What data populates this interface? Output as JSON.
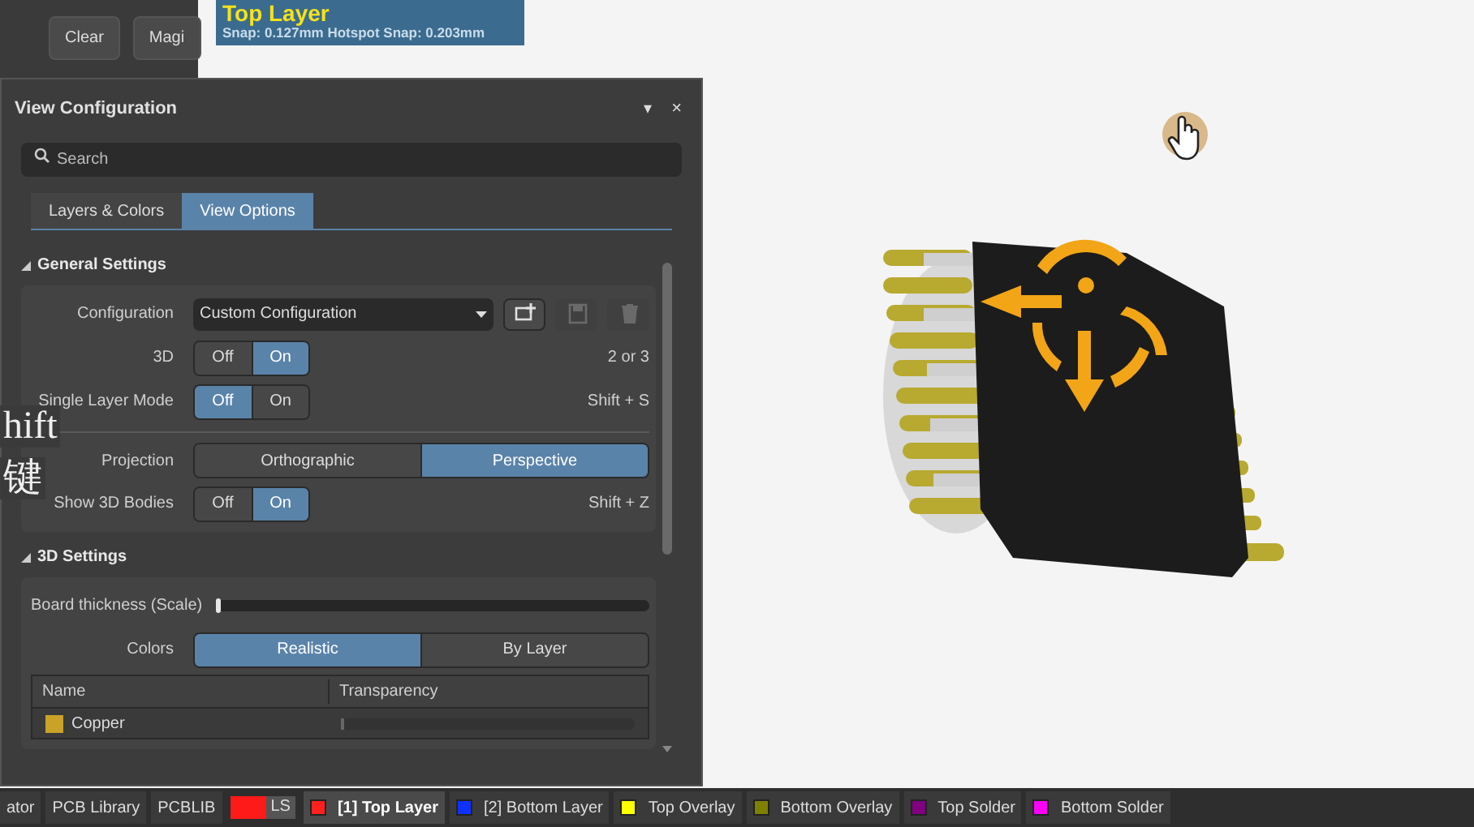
{
  "toolbar_fragment": {
    "buttons": [
      "Clear",
      "Magi"
    ]
  },
  "layer_info": {
    "layer": "Top Layer",
    "snap": "Snap: 0.127mm Hotspot Snap: 0.203mm"
  },
  "panel": {
    "title": "View Configuration",
    "menu_glyph": "▾",
    "close_glyph": "×",
    "search": {
      "placeholder": "Search"
    },
    "tabs": [
      {
        "label": "Layers & Colors",
        "selected": false
      },
      {
        "label": "View Options",
        "selected": true
      }
    ],
    "sections": [
      {
        "title": "General Settings",
        "expanded": true,
        "rows": [
          {
            "kind": "dropdown",
            "label": "Configuration",
            "value": "Custom Configuration",
            "actions": [
              {
                "kind": "add",
                "disabled": false
              },
              {
                "kind": "save",
                "disabled": true
              },
              {
                "kind": "delete",
                "disabled": true
              }
            ]
          },
          {
            "kind": "toggle",
            "label": "3D",
            "options": [
              {
                "label": "Off",
                "selected": false
              },
              {
                "label": "On",
                "selected": true
              }
            ],
            "shortcut": "2 or 3"
          },
          {
            "kind": "toggle",
            "label": "Single Layer Mode",
            "options": [
              {
                "label": "Off",
                "selected": true
              },
              {
                "label": "On",
                "selected": false
              }
            ],
            "shortcut": "Shift + S"
          },
          {
            "kind": "segmented",
            "label": "Projection",
            "separated": true,
            "options": [
              {
                "label": "Orthographic",
                "selected": false
              },
              {
                "label": "Perspective",
                "selected": true
              }
            ]
          },
          {
            "kind": "toggle",
            "label": "Show 3D Bodies",
            "options": [
              {
                "label": "Off",
                "selected": false
              },
              {
                "label": "On",
                "selected": true
              }
            ],
            "shortcut": "Shift + Z"
          }
        ]
      },
      {
        "title": "3D Settings",
        "expanded": true,
        "rows": [
          {
            "kind": "slider",
            "label": "Board thickness (Scale)",
            "level": 0
          },
          {
            "kind": "segmented",
            "label": "Colors",
            "options": [
              {
                "label": "Realistic",
                "selected": true
              },
              {
                "label": "By Layer",
                "selected": false
              }
            ]
          },
          {
            "kind": "table",
            "columns": [
              "Name",
              "Transparency"
            ],
            "rows": [
              {
                "name": "Copper",
                "color": "#c9a227",
                "level": 0
              }
            ]
          }
        ]
      }
    ]
  },
  "captions": [
    "hift",
    "键"
  ],
  "status_bar": {
    "documents": [
      {
        "label": "ator",
        "selected": false
      },
      {
        "label": "PCB Library",
        "selected": false
      },
      {
        "label": "PCBLIB",
        "selected": false
      }
    ],
    "ls": {
      "label": "LS",
      "color": "#ff1a1a"
    },
    "layers": [
      {
        "label": "[1] Top Layer",
        "color": "#ff2020",
        "selected": true
      },
      {
        "label": "[2] Bottom Layer",
        "color": "#1030ff",
        "selected": false
      },
      {
        "label": "Top Overlay",
        "color": "#ffff00",
        "selected": false
      },
      {
        "label": "Bottom Overlay",
        "color": "#808000",
        "selected": false
      },
      {
        "label": "Top Solder",
        "color": "#800080",
        "selected": false
      },
      {
        "label": "Bottom Solder",
        "color": "#ff00ff",
        "selected": false
      }
    ]
  }
}
